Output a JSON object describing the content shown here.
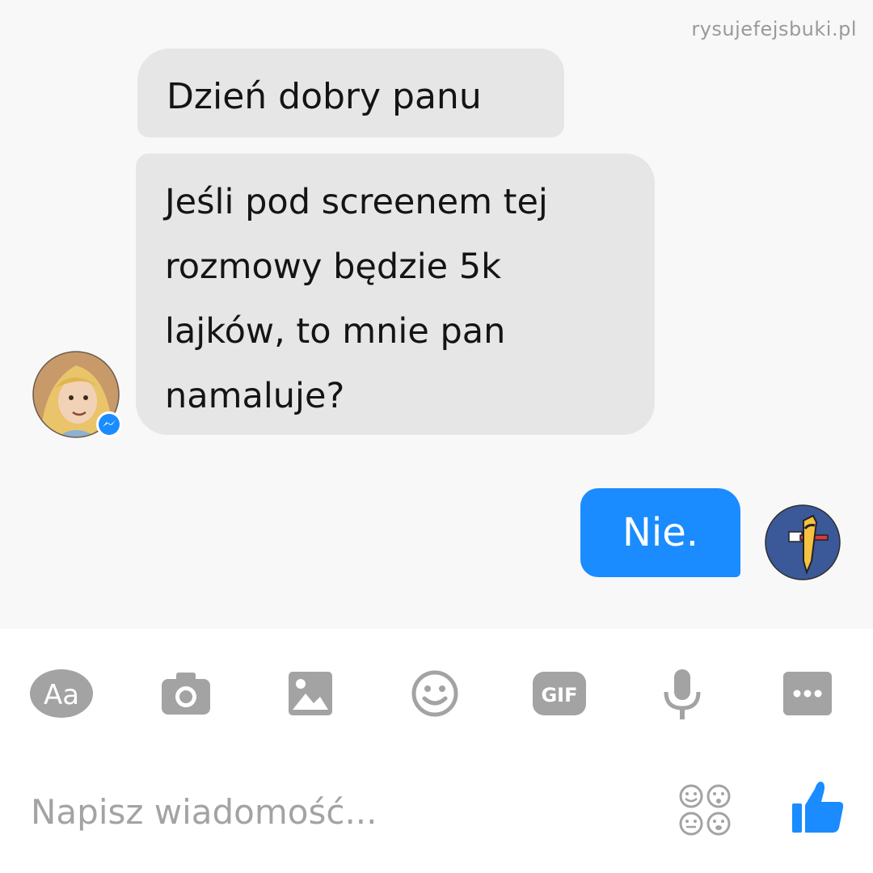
{
  "watermark": "rysujefejsbuki.pl",
  "messages": {
    "incoming_1": "Dzień dobry panu",
    "incoming_2": "Jeśli pod screenem tej\nrozmowy będzie 5k\nlajków, to mnie pan\nnamaluje?",
    "outgoing_1": "Nie."
  },
  "toolbar": {
    "text_label": "Aa",
    "gif_label": "GIF",
    "icons": [
      "text-format-icon",
      "camera-icon",
      "image-icon",
      "emoji-icon",
      "gif-icon",
      "microphone-icon",
      "more-icon"
    ]
  },
  "composer": {
    "placeholder": "Napisz wiadomość..."
  },
  "colors": {
    "accent": "#1a8cff",
    "bubble_in": "#e6e6e6",
    "icon_gray": "#a0a0a0",
    "avatar_right_bg": "#3b5998"
  }
}
